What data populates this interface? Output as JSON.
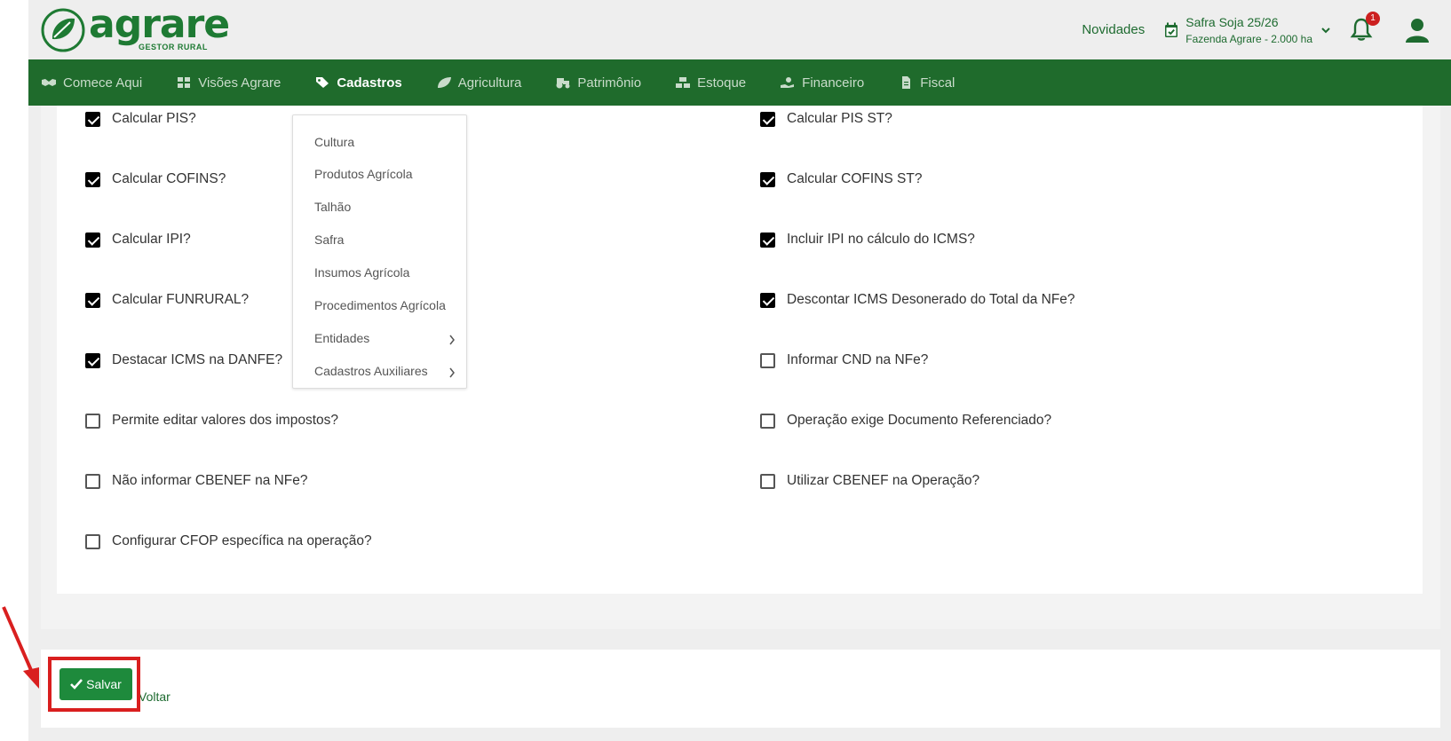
{
  "header": {
    "logo_text": "agrare",
    "logo_sub": "GESTOR RURAL",
    "novidades": "Novidades",
    "safra_title": "Safra Soja 25/26",
    "safra_sub": "Fazenda Agrare - 2.000 ha",
    "notif_count": "1"
  },
  "nav": {
    "items": [
      {
        "label": "Comece Aqui",
        "icon": "handshake-icon"
      },
      {
        "label": "Visões Agrare",
        "icon": "dashboard-icon"
      },
      {
        "label": "Cadastros",
        "icon": "tag-icon"
      },
      {
        "label": "Agricultura",
        "icon": "leaf-icon"
      },
      {
        "label": "Patrimônio",
        "icon": "tractor-icon"
      },
      {
        "label": "Estoque",
        "icon": "boxes-icon"
      },
      {
        "label": "Financeiro",
        "icon": "hand-money-icon"
      },
      {
        "label": "Fiscal",
        "icon": "file-icon"
      }
    ],
    "active": "Cadastros"
  },
  "form": {
    "left": [
      {
        "label": "Calcular PIS?",
        "checked": true
      },
      {
        "label": "Calcular COFINS?",
        "checked": true
      },
      {
        "label": "Calcular IPI?",
        "checked": true
      },
      {
        "label": "Calcular FUNRURAL?",
        "checked": true
      },
      {
        "label": "Destacar ICMS na DANFE?",
        "checked": true
      },
      {
        "label": "Permite editar valores dos impostos?",
        "checked": false
      },
      {
        "label": "Não informar CBENEF na NFe?",
        "checked": false
      },
      {
        "label": "Configurar CFOP específica na operação?",
        "checked": false
      }
    ],
    "right": [
      {
        "label": "Calcular PIS ST?",
        "checked": true
      },
      {
        "label": "Calcular COFINS ST?",
        "checked": true
      },
      {
        "label": "Incluir IPI no cálculo do ICMS?",
        "checked": true
      },
      {
        "label": "Descontar ICMS Desonerado do Total da NFe?",
        "checked": true
      },
      {
        "label": "Informar CND na NFe?",
        "checked": false
      },
      {
        "label": "Operação exige Documento Referenciado?",
        "checked": false
      },
      {
        "label": "Utilizar CBENEF na Operação?",
        "checked": false
      }
    ]
  },
  "dropdown": {
    "items": [
      {
        "label": "Cultura",
        "submenu": false
      },
      {
        "label": "Produtos Agrícola",
        "submenu": false
      },
      {
        "label": "Talhão",
        "submenu": false
      },
      {
        "label": "Safra",
        "submenu": false
      },
      {
        "label": "Insumos Agrícola",
        "submenu": false
      },
      {
        "label": "Procedimentos Agrícola",
        "submenu": false
      },
      {
        "label": "Entidades",
        "submenu": true
      },
      {
        "label": "Cadastros Auxiliares",
        "submenu": true
      }
    ]
  },
  "footer": {
    "save_label": "Salvar",
    "back_label": "Voltar"
  },
  "colors": {
    "brand_green": "#1f6b2c",
    "save_green": "#1e8a3c",
    "highlight_red": "#d91f1f"
  }
}
